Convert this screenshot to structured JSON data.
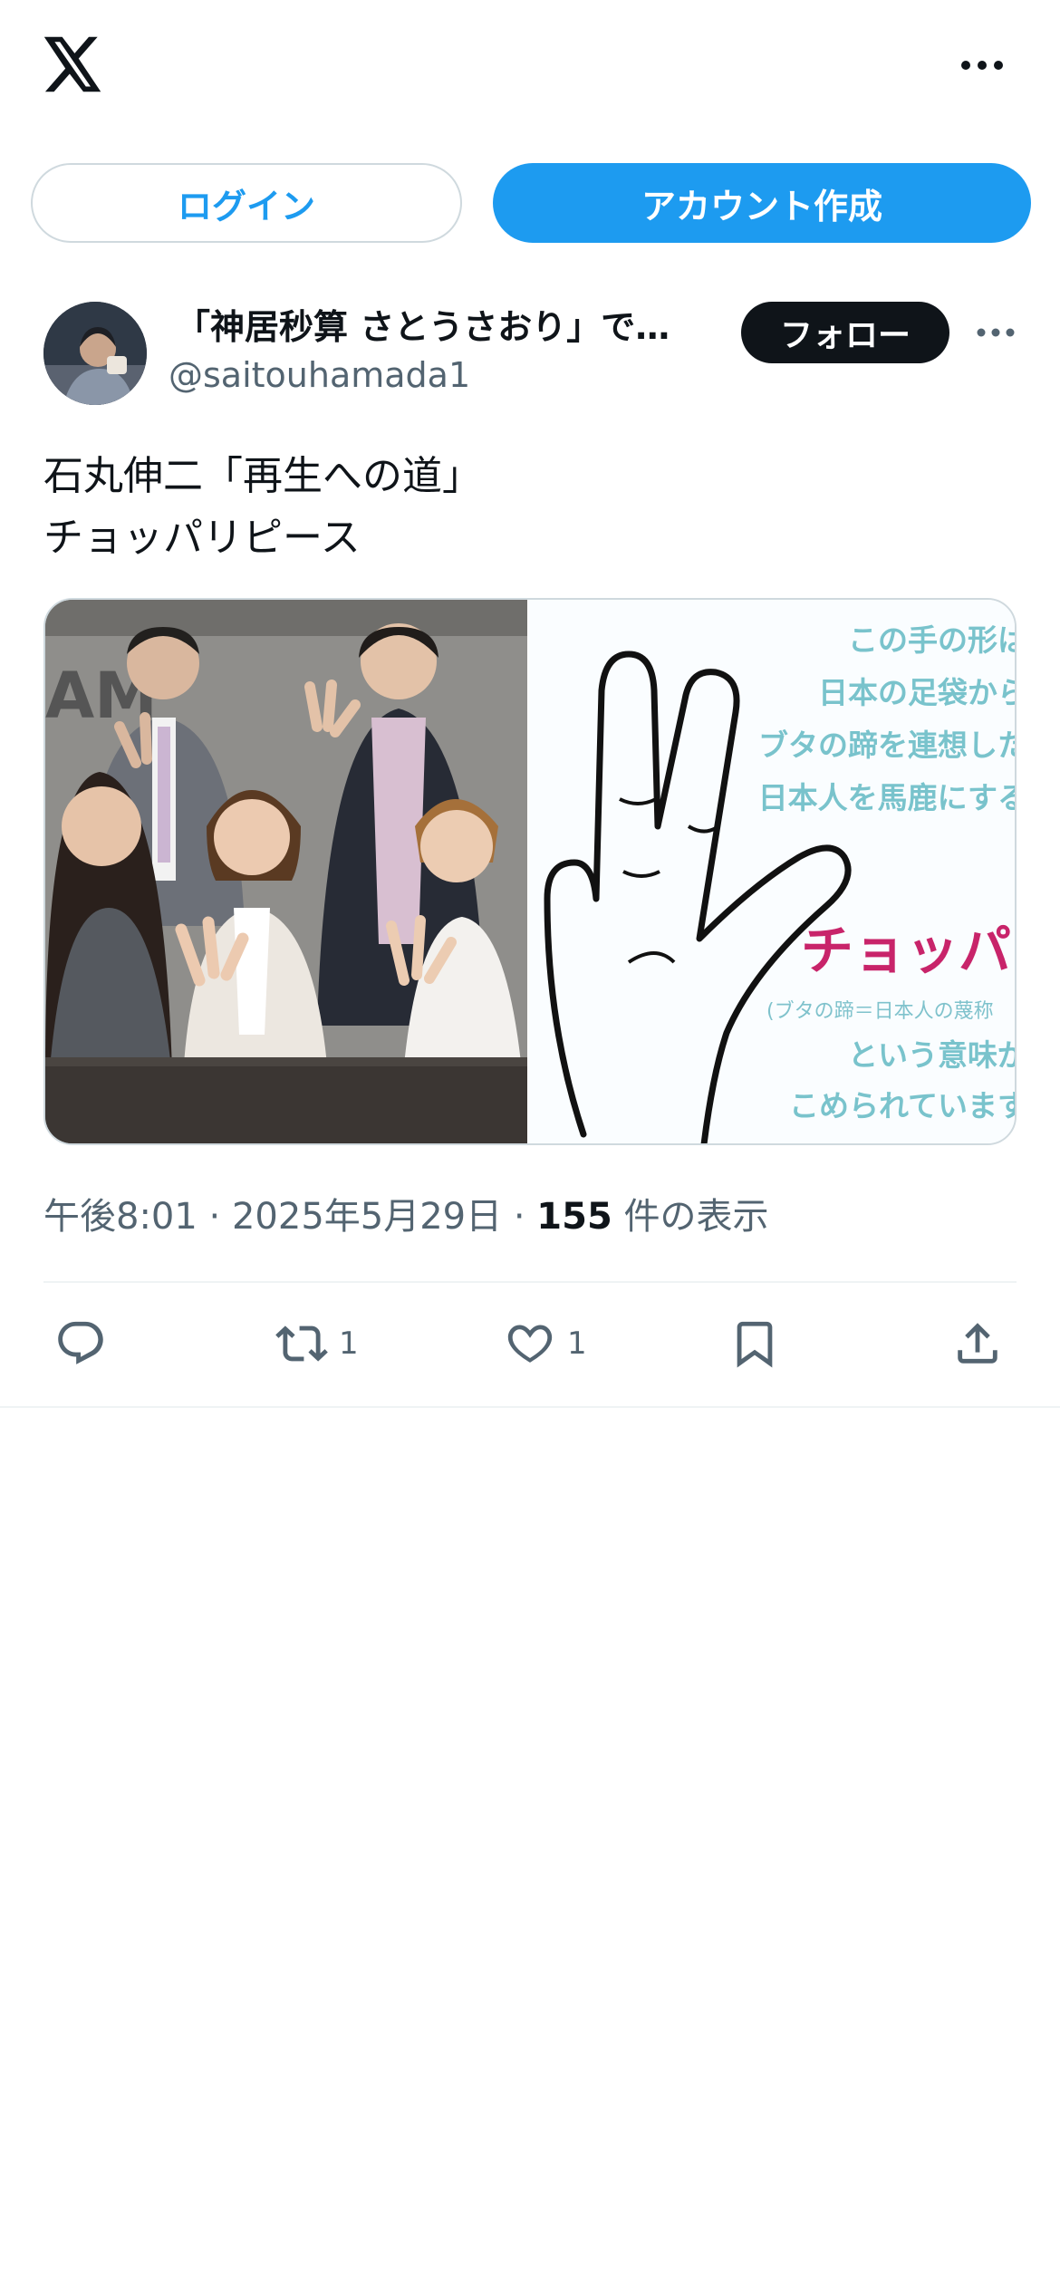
{
  "app": {
    "logo": "x-logo-icon",
    "more_icon": "more-horizontal-icon"
  },
  "auth": {
    "login_label": "ログイン",
    "signup_label": "アカウント作成"
  },
  "post": {
    "author_name": "「神居秒算 さとうさおり」で…",
    "author_handle": "@saitouhamada1",
    "follow_label": "フォロー",
    "text_lines": [
      "石丸伸二「再生への道」",
      "チョッパリピース"
    ],
    "image_text": {
      "lines": [
        "この手の形は",
        "日本の足袋から",
        "ブタの蹄を連想した",
        "日本人を馬鹿にする"
      ],
      "highlight": "チョッパリ",
      "note": "(ブタの蹄＝日本人の蔑称",
      "lines_bottom": [
        "という意味が",
        "こめられています"
      ]
    },
    "meta": {
      "time": "午後8:01",
      "date": "2025年5月29日",
      "views_count": "155",
      "views_label": "件の表示",
      "separator": "·"
    },
    "actions": {
      "reply": {
        "icon": "reply-icon",
        "count": ""
      },
      "repost": {
        "icon": "repost-icon",
        "count": "1"
      },
      "like": {
        "icon": "heart-icon",
        "count": "1"
      },
      "bookmark": {
        "icon": "bookmark-icon",
        "count": ""
      },
      "share": {
        "icon": "share-icon",
        "count": ""
      }
    }
  },
  "colors": {
    "accent": "#1d9bf0",
    "text": "#0f1419",
    "secondary": "#536471",
    "border": "#cfd9de",
    "highlight": "#c8246a"
  }
}
